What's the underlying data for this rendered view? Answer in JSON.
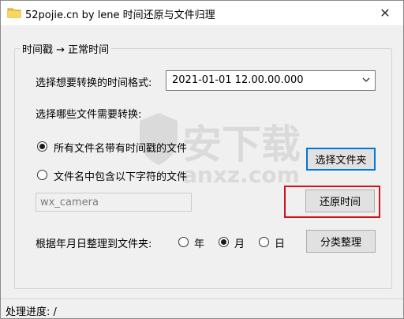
{
  "window": {
    "title": "52pojie.cn by lene 时间还原与文件归理",
    "close_glyph": "✕"
  },
  "group": {
    "legend": "时间戳 → 正常时间"
  },
  "format": {
    "label": "选择想要转换的时间格式:",
    "selected": "2021-01-01 12.00.00.000"
  },
  "files": {
    "label": "选择哪些文件需要转换:",
    "option_all": "所有文件名带有时间戳的文件",
    "option_contains": "文件名中包含以下字符的文件",
    "selected_option": "option_all",
    "filter_value": "wx_camera"
  },
  "buttons": {
    "select_folder": "选择文件夹",
    "restore_time": "还原时间",
    "classify": "分类整理"
  },
  "organize": {
    "label": "根据年月日整理到文件夹:",
    "year": "年",
    "month": "月",
    "day": "日",
    "selected": "month"
  },
  "watermark": {
    "text": "安下载",
    "sub": "anxz.com"
  },
  "status": {
    "text": "处理进度: /"
  },
  "colors": {
    "highlight": "#d0121b",
    "focus": "#0078d7"
  }
}
